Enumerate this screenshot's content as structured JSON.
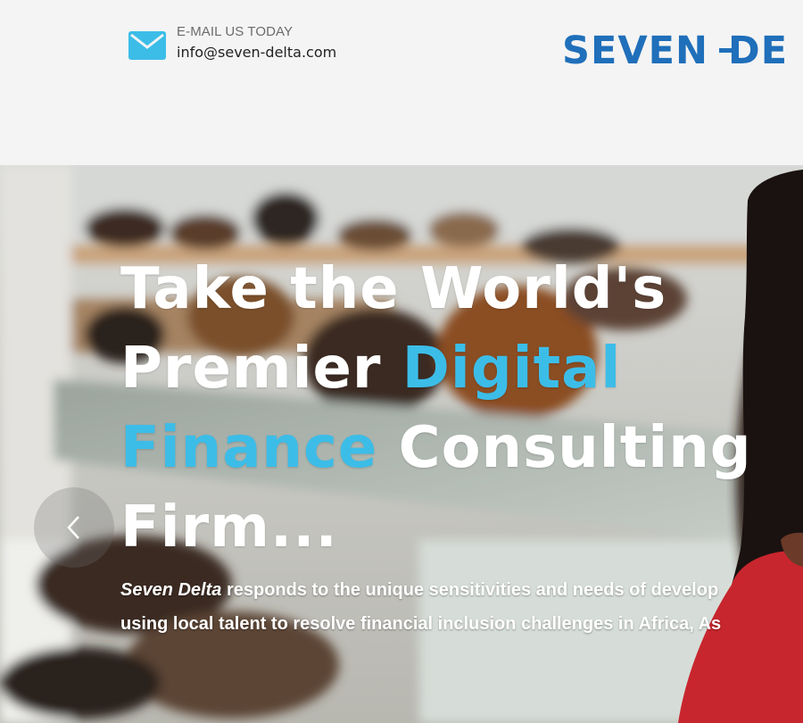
{
  "header": {
    "contact": {
      "label": "E-MAIL US TODAY",
      "email": "info@seven-delta.com",
      "icon": "envelope-icon"
    },
    "logo": {
      "text_part1": "SEVEN",
      "text_part2": "DE",
      "color": "#1f6fba"
    }
  },
  "hero": {
    "headline": {
      "line1": "Take the World's",
      "line2_white": "Premier ",
      "line2_accent": "Digital",
      "line3_accent": "Finance",
      "line3_white": " Consulting",
      "line4": "Firm..."
    },
    "tagline": {
      "brand": "Seven Delta",
      "line1_rest": " responds to the unique sensitivities and needs of develop",
      "line2": "using local talent to resolve financial inclusion challenges in Africa, As"
    },
    "prev_icon": "chevron-left-icon"
  },
  "colors": {
    "accent": "#3cbde8",
    "brand": "#1f6fba",
    "header_bg": "#f4f4f4"
  }
}
